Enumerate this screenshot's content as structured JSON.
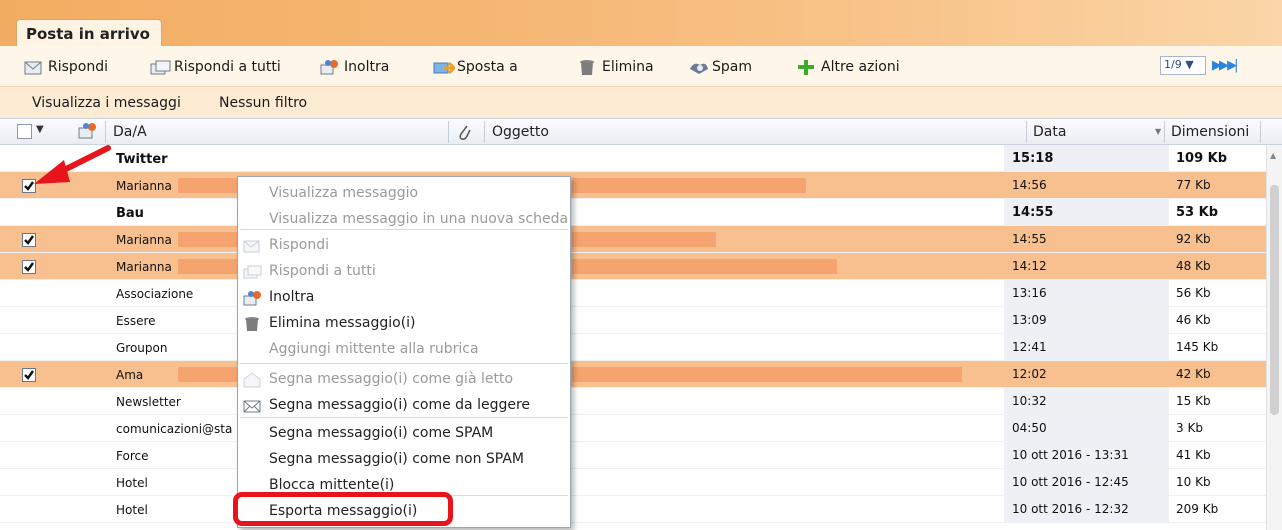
{
  "tab": {
    "title": "Posta in arrivo"
  },
  "toolbar": {
    "buttons": [
      {
        "label": "Rispondi",
        "icon": "reply-icon"
      },
      {
        "label": "Rispondi a tutti",
        "icon": "reply-all-icon"
      },
      {
        "label": "Inoltra",
        "icon": "forward-icon"
      },
      {
        "label": "Sposta a",
        "icon": "move-icon"
      },
      {
        "label": "Elimina",
        "icon": "trash-icon"
      },
      {
        "label": "Spam",
        "icon": "spam-icon"
      },
      {
        "label": "Altre azioni",
        "icon": "plus-icon"
      }
    ],
    "pager": {
      "value": "1/9 ▼",
      "nav": "▶▶ ▶|"
    }
  },
  "filterbar": {
    "view": "Visualizza i messaggi",
    "filter": "Nessun filtro"
  },
  "columns": {
    "from": "Da/A",
    "subject": "Oggetto",
    "date": "Data",
    "size": "Dimensioni"
  },
  "messages": [
    {
      "from": "Twitter",
      "date": "15:18",
      "size": "109 Kb",
      "unread": true,
      "selected": false
    },
    {
      "from": "Marianna",
      "date": "14:56",
      "size": "77 Kb",
      "unread": false,
      "selected": true
    },
    {
      "from": "Bau",
      "date": "14:55",
      "size": "53 Kb",
      "unread": true,
      "selected": false
    },
    {
      "from": "Marianna",
      "date": "14:55",
      "size": "92 Kb",
      "unread": false,
      "selected": true
    },
    {
      "from": "Marianna",
      "date": "14:12",
      "size": "48 Kb",
      "unread": false,
      "selected": true
    },
    {
      "from": "Associazione",
      "date": "13:16",
      "size": "56 Kb",
      "unread": false,
      "selected": false
    },
    {
      "from": "Essere",
      "date": "13:09",
      "size": "46 Kb",
      "unread": false,
      "selected": false
    },
    {
      "from": "Groupon",
      "date": "12:41",
      "size": "145 Kb",
      "unread": false,
      "selected": false
    },
    {
      "from": "Ama",
      "date": "12:02",
      "size": "42 Kb",
      "unread": false,
      "selected": true
    },
    {
      "from": "Newsletter",
      "date": "10:32",
      "size": "15 Kb",
      "unread": false,
      "selected": false
    },
    {
      "from": "comunicazioni@sta",
      "date": "04:50",
      "size": "3 Kb",
      "unread": false,
      "selected": false
    },
    {
      "from": "Force",
      "date": "10 ott 2016 - 13:31",
      "size": "41 Kb",
      "unread": false,
      "selected": false
    },
    {
      "from": "Hotel",
      "date": "10 ott 2016 - 12:45",
      "size": "10 Kb",
      "unread": false,
      "selected": false
    },
    {
      "from": "Hotel",
      "date": "10 ott 2016 - 12:32",
      "size": "209 Kb",
      "unread": false,
      "selected": false
    }
  ],
  "context_menu": {
    "items": [
      {
        "label": "Visualizza messaggio",
        "enabled": false
      },
      {
        "label": "Visualizza messaggio in una nuova scheda",
        "enabled": false
      },
      {
        "label": "Rispondi",
        "enabled": false,
        "icon": "reply-icon"
      },
      {
        "label": "Rispondi a tutti",
        "enabled": false,
        "icon": "reply-all-icon"
      },
      {
        "label": "Inoltra",
        "enabled": true,
        "icon": "forward-icon"
      },
      {
        "label": "Elimina messaggio(i)",
        "enabled": true,
        "icon": "trash-icon"
      },
      {
        "label": "Aggiungi mittente alla rubrica",
        "enabled": false
      },
      {
        "label": "Segna messaggio(i) come già letto",
        "enabled": false,
        "icon": "open-envelope-icon"
      },
      {
        "label": "Segna messaggio(i) come da leggere",
        "enabled": true,
        "icon": "envelope-icon"
      },
      {
        "label": "Segna messaggio(i) come SPAM",
        "enabled": true
      },
      {
        "label": "Segna messaggio(i) come non SPAM",
        "enabled": true
      },
      {
        "label": "Blocca mittente(i)",
        "enabled": true
      },
      {
        "label": "Esporta messaggio(i)",
        "enabled": true
      }
    ]
  },
  "colors": {
    "accent_orange": "#f8c08e",
    "highlight_red": "#e8131b",
    "toolbar_bg": "#fff6ea",
    "filter_bg": "#fdebd4"
  }
}
